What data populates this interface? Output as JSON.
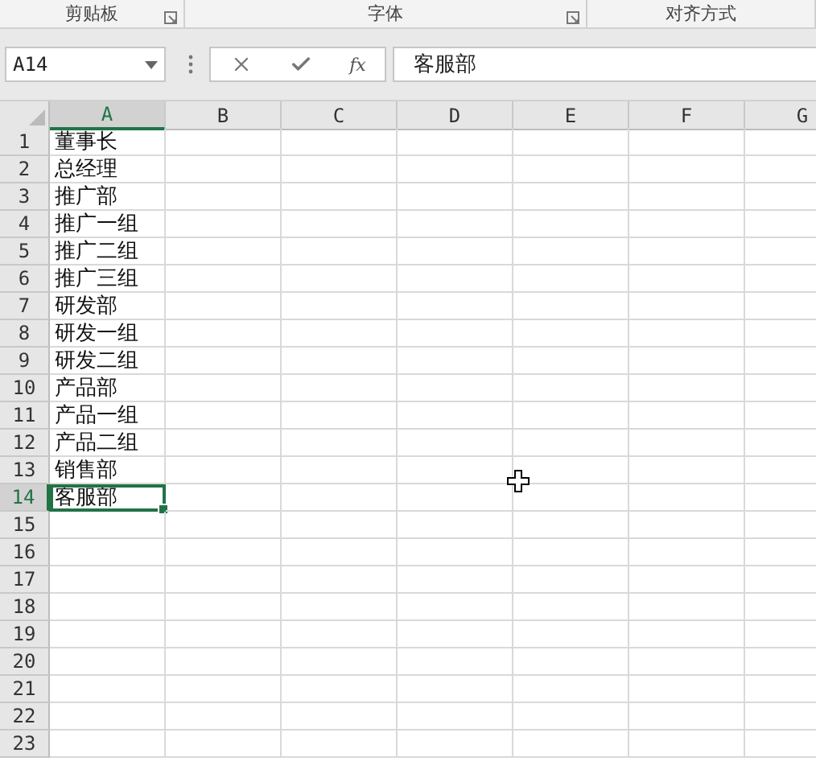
{
  "ribbon_groups": [
    {
      "label": "剪贴板",
      "launcher": true
    },
    {
      "label": "字体",
      "launcher": true
    },
    {
      "label": "对齐方式",
      "launcher": false
    }
  ],
  "name_box": {
    "value": "A14"
  },
  "formula_bar": {
    "function_label": "fx",
    "value": "客服部"
  },
  "columns": [
    {
      "label": "A",
      "selected": true
    },
    {
      "label": "B",
      "selected": false
    },
    {
      "label": "C",
      "selected": false
    },
    {
      "label": "D",
      "selected": false
    },
    {
      "label": "E",
      "selected": false
    },
    {
      "label": "F",
      "selected": false
    },
    {
      "label": "G",
      "selected": false
    }
  ],
  "rows": [
    {
      "label": "1",
      "selected": false,
      "a": "董事长"
    },
    {
      "label": "2",
      "selected": false,
      "a": "总经理"
    },
    {
      "label": "3",
      "selected": false,
      "a": "推广部"
    },
    {
      "label": "4",
      "selected": false,
      "a": "推广一组"
    },
    {
      "label": "5",
      "selected": false,
      "a": "推广二组"
    },
    {
      "label": "6",
      "selected": false,
      "a": "推广三组"
    },
    {
      "label": "7",
      "selected": false,
      "a": "研发部"
    },
    {
      "label": "8",
      "selected": false,
      "a": "研发一组"
    },
    {
      "label": "9",
      "selected": false,
      "a": "研发二组"
    },
    {
      "label": "10",
      "selected": false,
      "a": "产品部"
    },
    {
      "label": "11",
      "selected": false,
      "a": "产品一组"
    },
    {
      "label": "12",
      "selected": false,
      "a": "产品二组"
    },
    {
      "label": "13",
      "selected": false,
      "a": "销售部"
    },
    {
      "label": "14",
      "selected": true,
      "a": "客服部"
    },
    {
      "label": "15",
      "selected": false
    },
    {
      "label": "16",
      "selected": false
    },
    {
      "label": "17",
      "selected": false
    },
    {
      "label": "18",
      "selected": false
    },
    {
      "label": "19",
      "selected": false
    },
    {
      "label": "20",
      "selected": false
    },
    {
      "label": "21",
      "selected": false
    },
    {
      "label": "22",
      "selected": false
    },
    {
      "label": "23",
      "selected": false
    }
  ]
}
